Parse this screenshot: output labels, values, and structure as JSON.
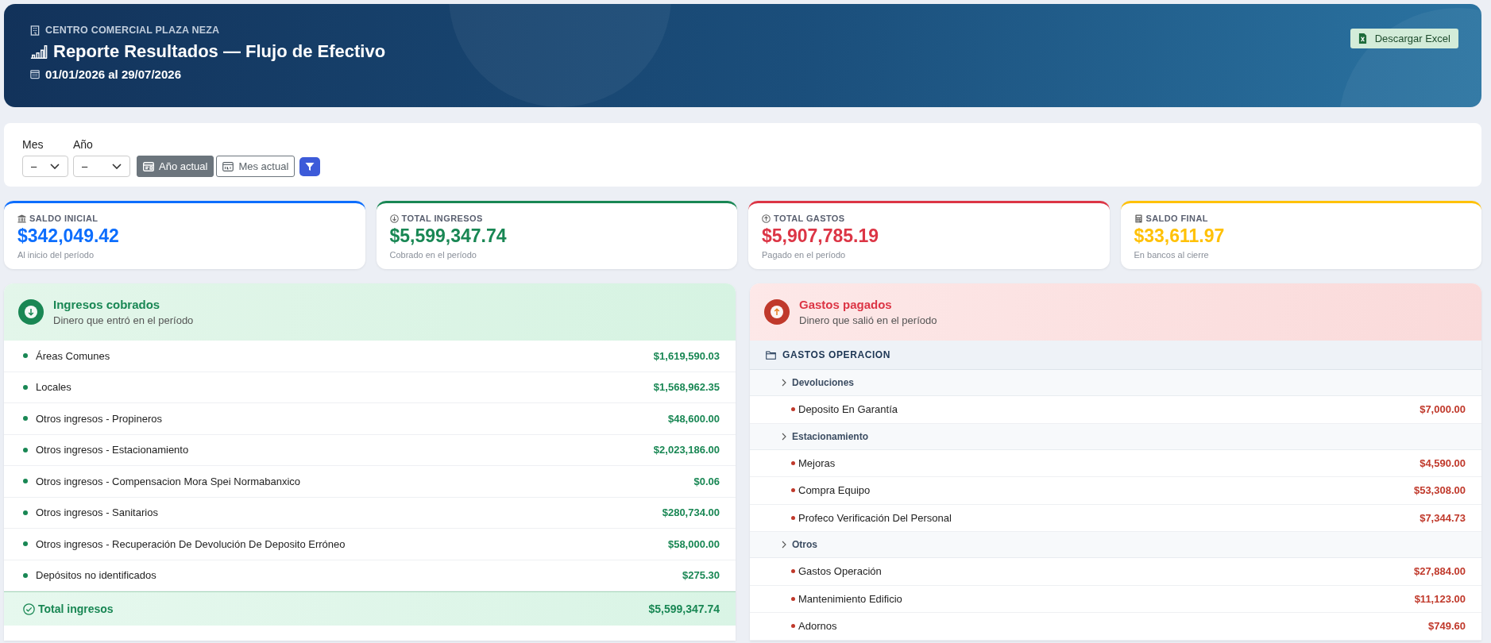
{
  "header": {
    "organization": "CENTRO COMERCIAL PLAZA NEZA",
    "title": "Reporte Resultados — Flujo de Efectivo",
    "period": "01/01/2026 al 29/07/2026",
    "export_button": "Descargar Excel"
  },
  "filters": {
    "fields": [
      {
        "label": "Mes",
        "value": "–"
      },
      {
        "label": "Año",
        "value": "–"
      }
    ],
    "buttons": [
      {
        "kind": "year",
        "label": "Año actual",
        "selected": true
      },
      {
        "kind": "month",
        "label": "Mes actual",
        "selected": false
      },
      {
        "kind": "filter"
      }
    ]
  },
  "summary_cards": [
    {
      "kind": "opening",
      "label": "SALDO INICIAL",
      "value": "$342,049.42",
      "note": "Al inicio del período",
      "color": "#0d6efd"
    },
    {
      "kind": "income",
      "label": "TOTAL INGRESOS",
      "value": "$5,599,347.74",
      "note": "Cobrado en el período",
      "color": "#198754"
    },
    {
      "kind": "expense",
      "label": "TOTAL GASTOS",
      "value": "$5,907,785.19",
      "note": "Pagado en el período",
      "color": "#dc3545"
    },
    {
      "kind": "closing",
      "label": "SALDO FINAL",
      "value": "$33,611.97",
      "note": "En bancos al cierre",
      "color": "#ffc107"
    }
  ],
  "income": {
    "title": "Ingresos cobrados",
    "subtitle": "Dinero que entró en el período",
    "rows": [
      {
        "label": "Áreas Comunes",
        "amount": "$1,619,590.03"
      },
      {
        "label": "Locales",
        "amount": "$1,568,962.35"
      },
      {
        "label": "Otros ingresos - Propineros",
        "amount": "$48,600.00"
      },
      {
        "label": "Otros ingresos - Estacionamiento",
        "amount": "$2,023,186.00"
      },
      {
        "label": "Otros ingresos - Compensacion Mora Spei Normabanxico",
        "amount": "$0.06"
      },
      {
        "label": "Otros ingresos - Sanitarios",
        "amount": "$280,734.00"
      },
      {
        "label": "Otros ingresos - Recuperación De Devolución De Deposito Erróneo",
        "amount": "$58,000.00"
      },
      {
        "label": "Depósitos no identificados",
        "amount": "$275.30"
      }
    ],
    "total": {
      "label": "Total ingresos",
      "amount": "$5,599,347.74"
    }
  },
  "expenses": {
    "title": "Gastos pagados",
    "subtitle": "Dinero que salió en el período",
    "categories": [
      {
        "label": "GASTOS OPERACION",
        "children": [
          {
            "label": "Devoluciones",
            "children": [
              {
                "label": "Deposito En Garantía",
                "amount": "$7,000.00"
              }
            ]
          },
          {
            "label": "Estacionamiento",
            "children": [
              {
                "label": "Mejoras",
                "amount": "$4,590.00"
              },
              {
                "label": "Compra Equipo",
                "amount": "$53,308.00"
              },
              {
                "label": "Profeco Verificación Del Personal",
                "amount": "$7,344.73"
              }
            ]
          },
          {
            "label": "Otros",
            "children": [
              {
                "label": "Gastos Operación",
                "amount": "$27,884.00"
              },
              {
                "label": "Mantenimiento Edificio",
                "amount": "$11,123.00"
              },
              {
                "label": "Adornos",
                "amount": "$749.60"
              }
            ]
          }
        ]
      }
    ]
  }
}
